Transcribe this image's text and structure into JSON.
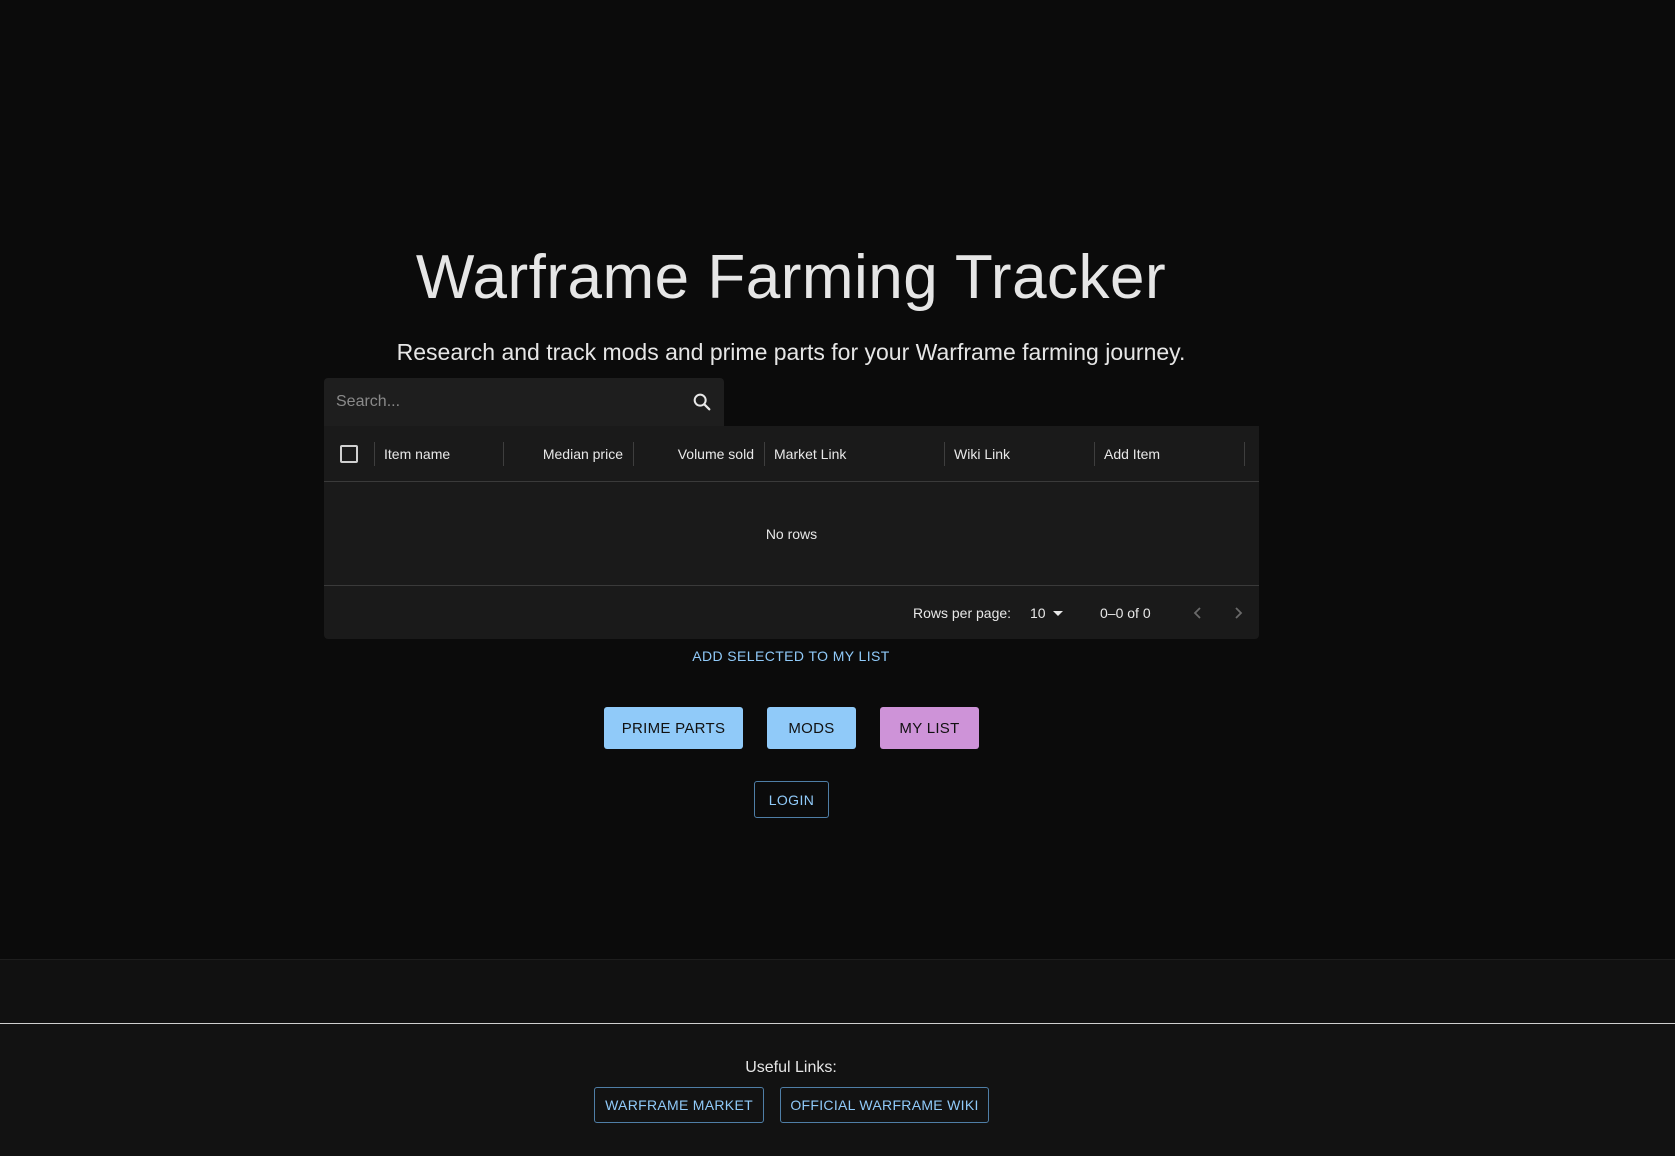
{
  "header": {
    "title": "Warframe Farming Tracker",
    "subtitle": "Research and track mods and prime parts for your Warframe farming journey."
  },
  "search": {
    "placeholder": "Search..."
  },
  "table": {
    "columns": [
      "Item name",
      "Median price",
      "Volume sold",
      "Market Link",
      "Wiki Link",
      "Add Item"
    ],
    "empty_text": "No rows",
    "rows_per_page_label": "Rows per page:",
    "rows_per_page_value": "10",
    "pagination_range": "0–0 of 0"
  },
  "actions": {
    "add_selected": "ADD SELECTED TO MY LIST"
  },
  "categories": {
    "prime_parts": "PRIME PARTS",
    "mods": "MODS",
    "my_list": "MY LIST"
  },
  "auth": {
    "login": "LOGIN"
  },
  "footer": {
    "useful_links_label": "Useful Links:",
    "market_link": "WARFRAME MARKET",
    "wiki_link": "OFFICIAL WARFRAME WIKI"
  },
  "colors": {
    "primary": "#90caf9",
    "secondary": "#ce93d8",
    "background": "#0b0b0b"
  }
}
